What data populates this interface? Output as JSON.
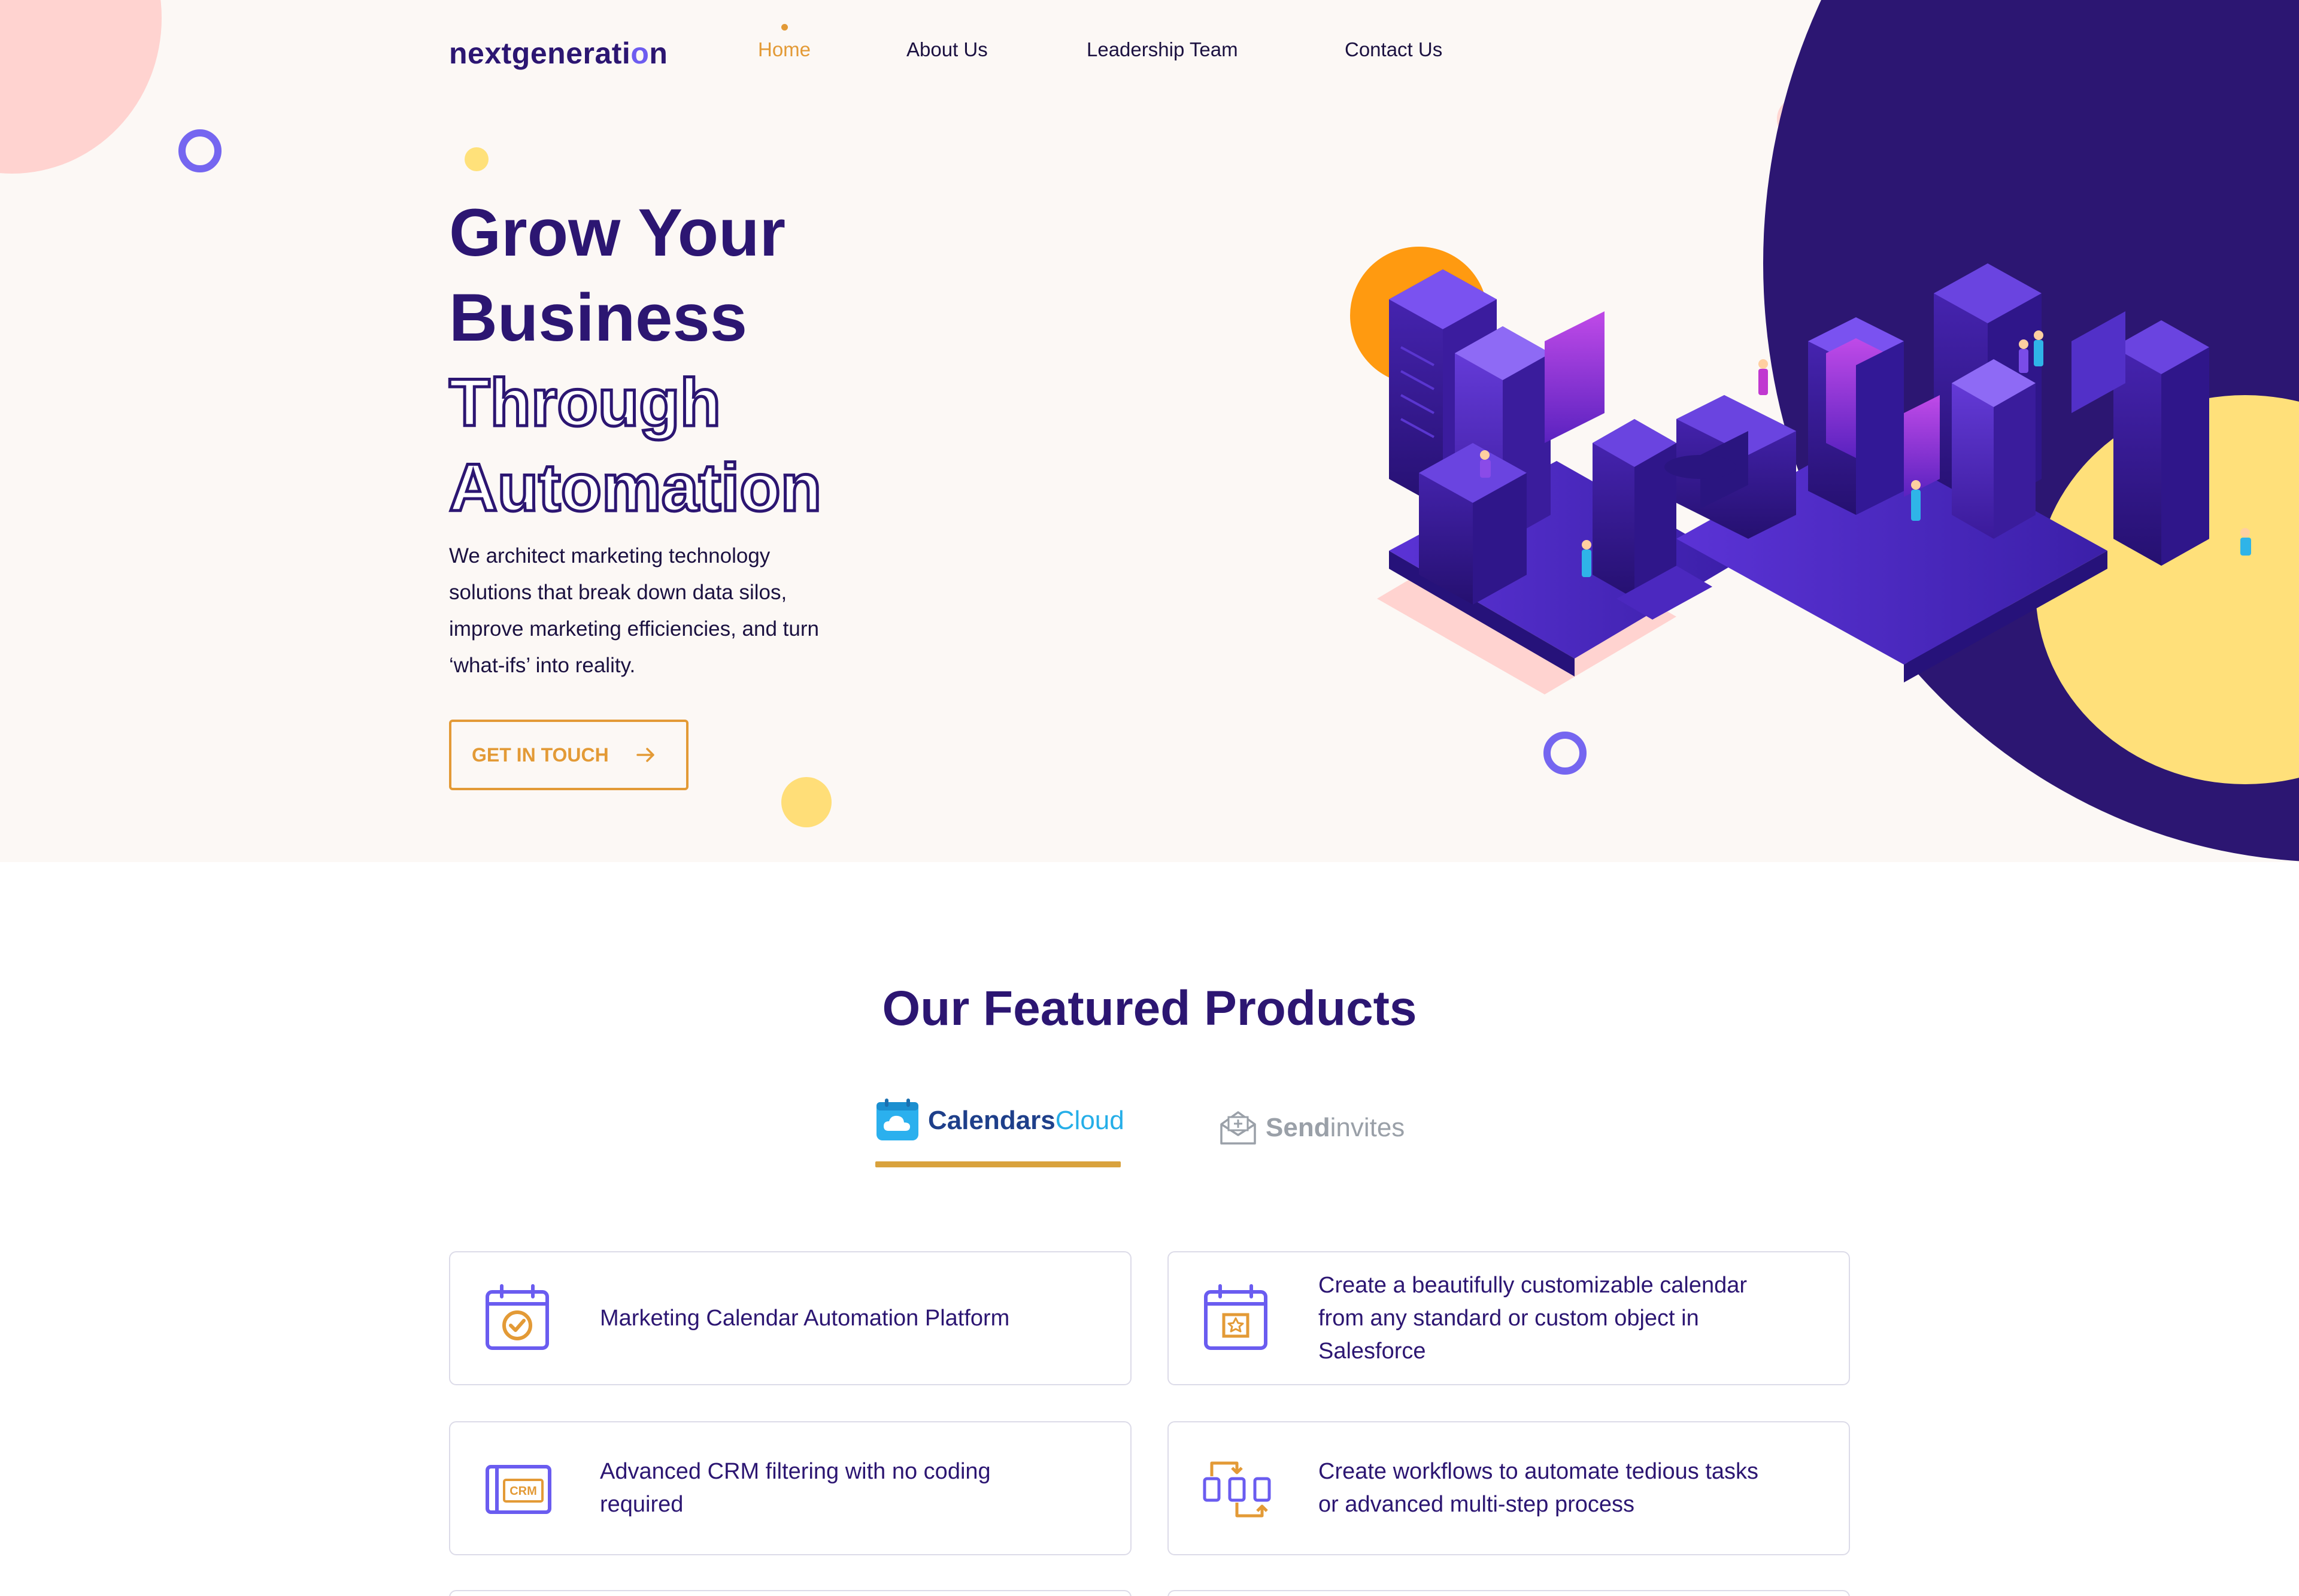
{
  "brand": {
    "logo_main": "nextgenerati",
    "logo_accent": "o",
    "logo_end": "n"
  },
  "nav": {
    "items": [
      {
        "label": "Home",
        "active": true
      },
      {
        "label": "About Us",
        "active": false
      },
      {
        "label": "Leadership Team",
        "active": false
      },
      {
        "label": "Contact Us",
        "active": false
      }
    ]
  },
  "hero": {
    "headline_line1": "Grow Your",
    "headline_line2": "Business",
    "headline_line3": "Through",
    "headline_line4": "Automation",
    "description_line1": "We architect marketing technology",
    "description_line2": "solutions that break down data silos,",
    "description_line3": "improve marketing efficiencies, and turn",
    "description_line4": "‘what-ifs’ into reality.",
    "cta_label": "GET IN TOUCH",
    "cta_icon": "arrow-right-icon"
  },
  "products": {
    "title": "Our Featured Products",
    "tabs": [
      {
        "label_bold": "Calendars",
        "label_light": "Cloud",
        "icon": "calendar-cloud-icon",
        "active": true
      },
      {
        "label_bold": "Send",
        "label_light": "invites",
        "icon": "envelope-icon",
        "active": false
      }
    ],
    "features": [
      {
        "text": "Marketing Calendar Automation Platform",
        "icon": "calendar-check-icon"
      },
      {
        "text": "Create a beautifully customizable calendar from any standard or custom object in Salesforce",
        "icon": "calendar-star-icon"
      },
      {
        "text": "Advanced CRM filtering with no coding required",
        "icon": "crm-window-icon"
      },
      {
        "text": "Create workflows to automate tedious tasks or advanced multi-step process",
        "icon": "workflow-icon"
      }
    ]
  },
  "colors": {
    "navy": "#2c1672",
    "accent_orange": "#e39a36",
    "purple": "#7566f0",
    "hero_bg": "#fcf8f5",
    "yellow": "#ffe07a",
    "pink": "#ffd3d0"
  }
}
